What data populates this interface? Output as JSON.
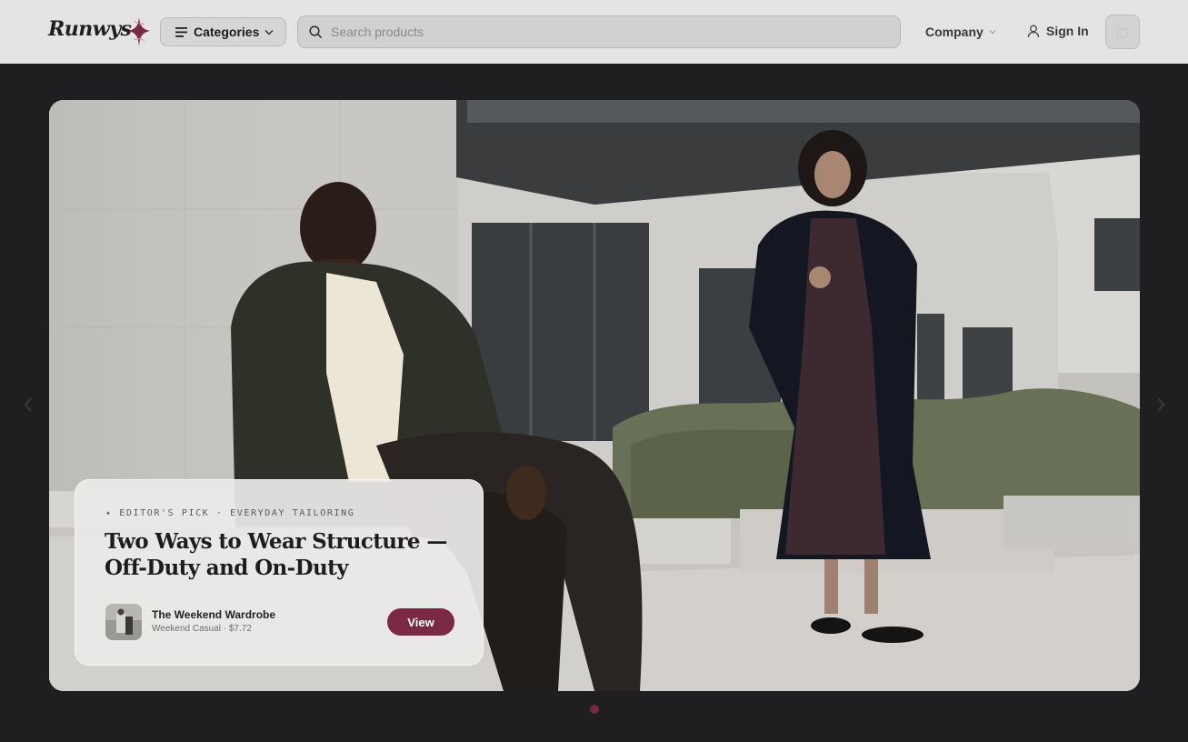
{
  "header": {
    "logo_text": "Runwys",
    "categories_label": "Categories",
    "search_placeholder": "Search products",
    "company_label": "Company",
    "signin_label": "Sign In"
  },
  "hero": {
    "eyebrow": "✦ EDITOR'S PICK · EVERYDAY TAILORING",
    "title": "Two Ways to Wear Structure — Off-Duty and On-Duty",
    "product": {
      "name": "The Weekend Wardrobe",
      "meta": "Weekend Casual · $7.72"
    },
    "view_label": "View"
  },
  "carousel": {
    "slide_count": 1,
    "active_slide": 1
  },
  "colors": {
    "accent": "#7a2a43",
    "header_bg": "#e4e4e4",
    "page_bg": "#1f1f21"
  },
  "icons": [
    "menu-icon",
    "chevron-down-icon",
    "search-icon",
    "user-icon",
    "cart-icon",
    "chevron-left-icon",
    "chevron-right-icon"
  ]
}
